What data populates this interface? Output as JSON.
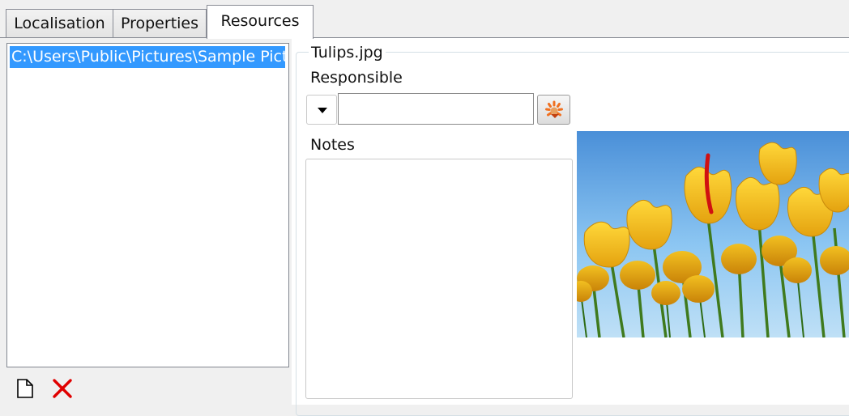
{
  "tabs": [
    {
      "label": "Localisation",
      "active": false
    },
    {
      "label": "Properties",
      "active": false
    },
    {
      "label": "Resources",
      "active": true
    }
  ],
  "resources": {
    "items": [
      {
        "label": "C:\\Users\\Public\\Pictures\\Sample Pictures\\Tulips.jpg",
        "selected": true
      }
    ],
    "toolbar": {
      "new_icon": "new-file-icon",
      "delete_icon": "delete-x-icon"
    }
  },
  "details": {
    "group_title": "Tulips.jpg",
    "responsible_label": "Responsible",
    "responsible_value": "",
    "notes_label": "Notes",
    "notes_value": "",
    "picker_icon": "picker-icon",
    "dropdown_icon": "chevron-down-icon",
    "preview_alt": "tulips"
  },
  "colors": {
    "selection": "#3399ff",
    "delete_icon": "#e00000",
    "picker_icon": "#f07020",
    "tab_border": "#898c95"
  }
}
